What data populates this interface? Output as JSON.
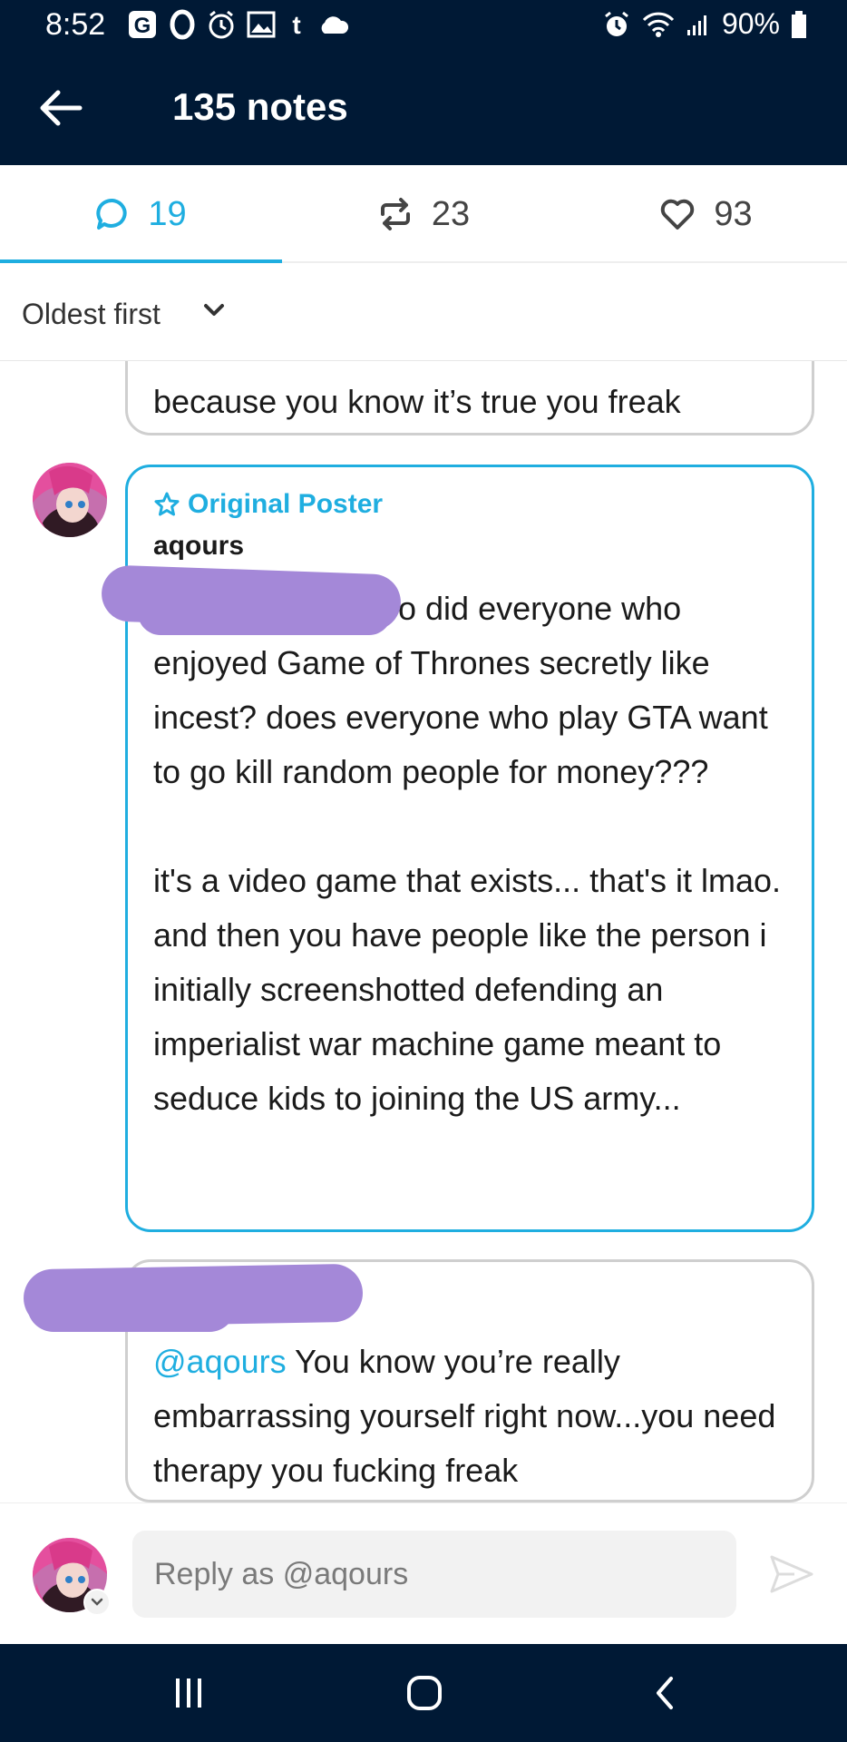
{
  "status_bar": {
    "time": "8:52",
    "left_icons": [
      "google-icon",
      "circle-o-icon",
      "alarm-clock-icon",
      "image-icon",
      "tumblr-icon",
      "cloud-icon"
    ],
    "right_icons": [
      "alarm-icon",
      "wifi-icon",
      "signal-icon",
      "battery-icon"
    ],
    "battery": "90%"
  },
  "app_bar": {
    "title": "135 notes"
  },
  "tabs": [
    {
      "icon": "comment-icon",
      "count": "19",
      "active": true
    },
    {
      "icon": "reblog-icon",
      "count": "23",
      "active": false
    },
    {
      "icon": "heart-icon",
      "count": "93",
      "active": false
    }
  ],
  "sort": {
    "label": "Oldest first"
  },
  "notes": [
    {
      "text": "because you know it’s true you freak"
    },
    {
      "badge": "Original Poster",
      "username": "aqours",
      "paragraph1": "o did everyone who enjoyed Game of Thrones secretly like incest? does everyone who play GTA want to go kill random people for money???",
      "paragraph2": "it's a video game that exists... that's it lmao. and then you have people like the person i initially screenshotted defending an imperialist war machine game meant to seduce kids to joining the US army..."
    },
    {
      "mention": "@aqours",
      "text": " You know you’re really embarrassing yourself right now...you need therapy you fucking freak"
    }
  ],
  "compose": {
    "placeholder": "Reply as @aqours"
  },
  "colors": {
    "navy": "#001935",
    "accent": "#1faee0",
    "redaction": "#a488d8"
  }
}
